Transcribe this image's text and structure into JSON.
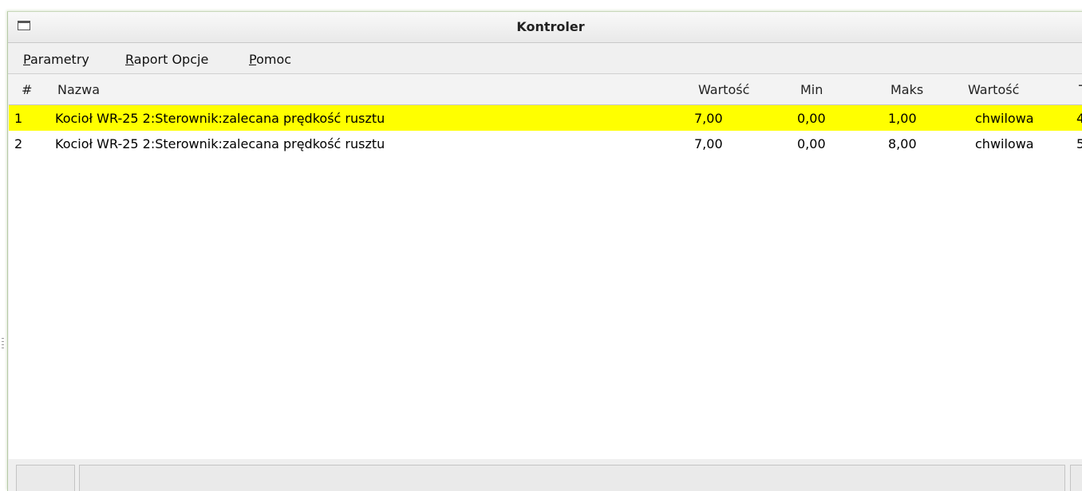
{
  "window": {
    "title": "Kontroler"
  },
  "menu": {
    "items": [
      {
        "mnemonic": "P",
        "rest": "arametry"
      },
      {
        "mnemonic": "R",
        "rest": "aport Opcje"
      },
      {
        "mnemonic": "P",
        "rest": "omoc"
      }
    ]
  },
  "table": {
    "columns": [
      "#",
      "Nazwa",
      "Wartość",
      "Min",
      "Maks",
      "Wartość",
      "T"
    ],
    "rows": [
      {
        "num": "1",
        "name": "Kocioł WR-25 2:Sterownik:zalecana prędkość rusztu",
        "value": "7,00",
        "min": "0,00",
        "max": "1,00",
        "kind": "chwilowa",
        "extra": "4",
        "selected": true
      },
      {
        "num": "2",
        "name": "Kocioł WR-25 2:Sterownik:zalecana prędkość rusztu",
        "value": "7,00",
        "min": "0,00",
        "max": "8,00",
        "kind": "chwilowa",
        "extra": "5",
        "selected": false
      }
    ]
  },
  "colors": {
    "selected_row": "#ffff00",
    "window_border": "#b5c9a6"
  }
}
